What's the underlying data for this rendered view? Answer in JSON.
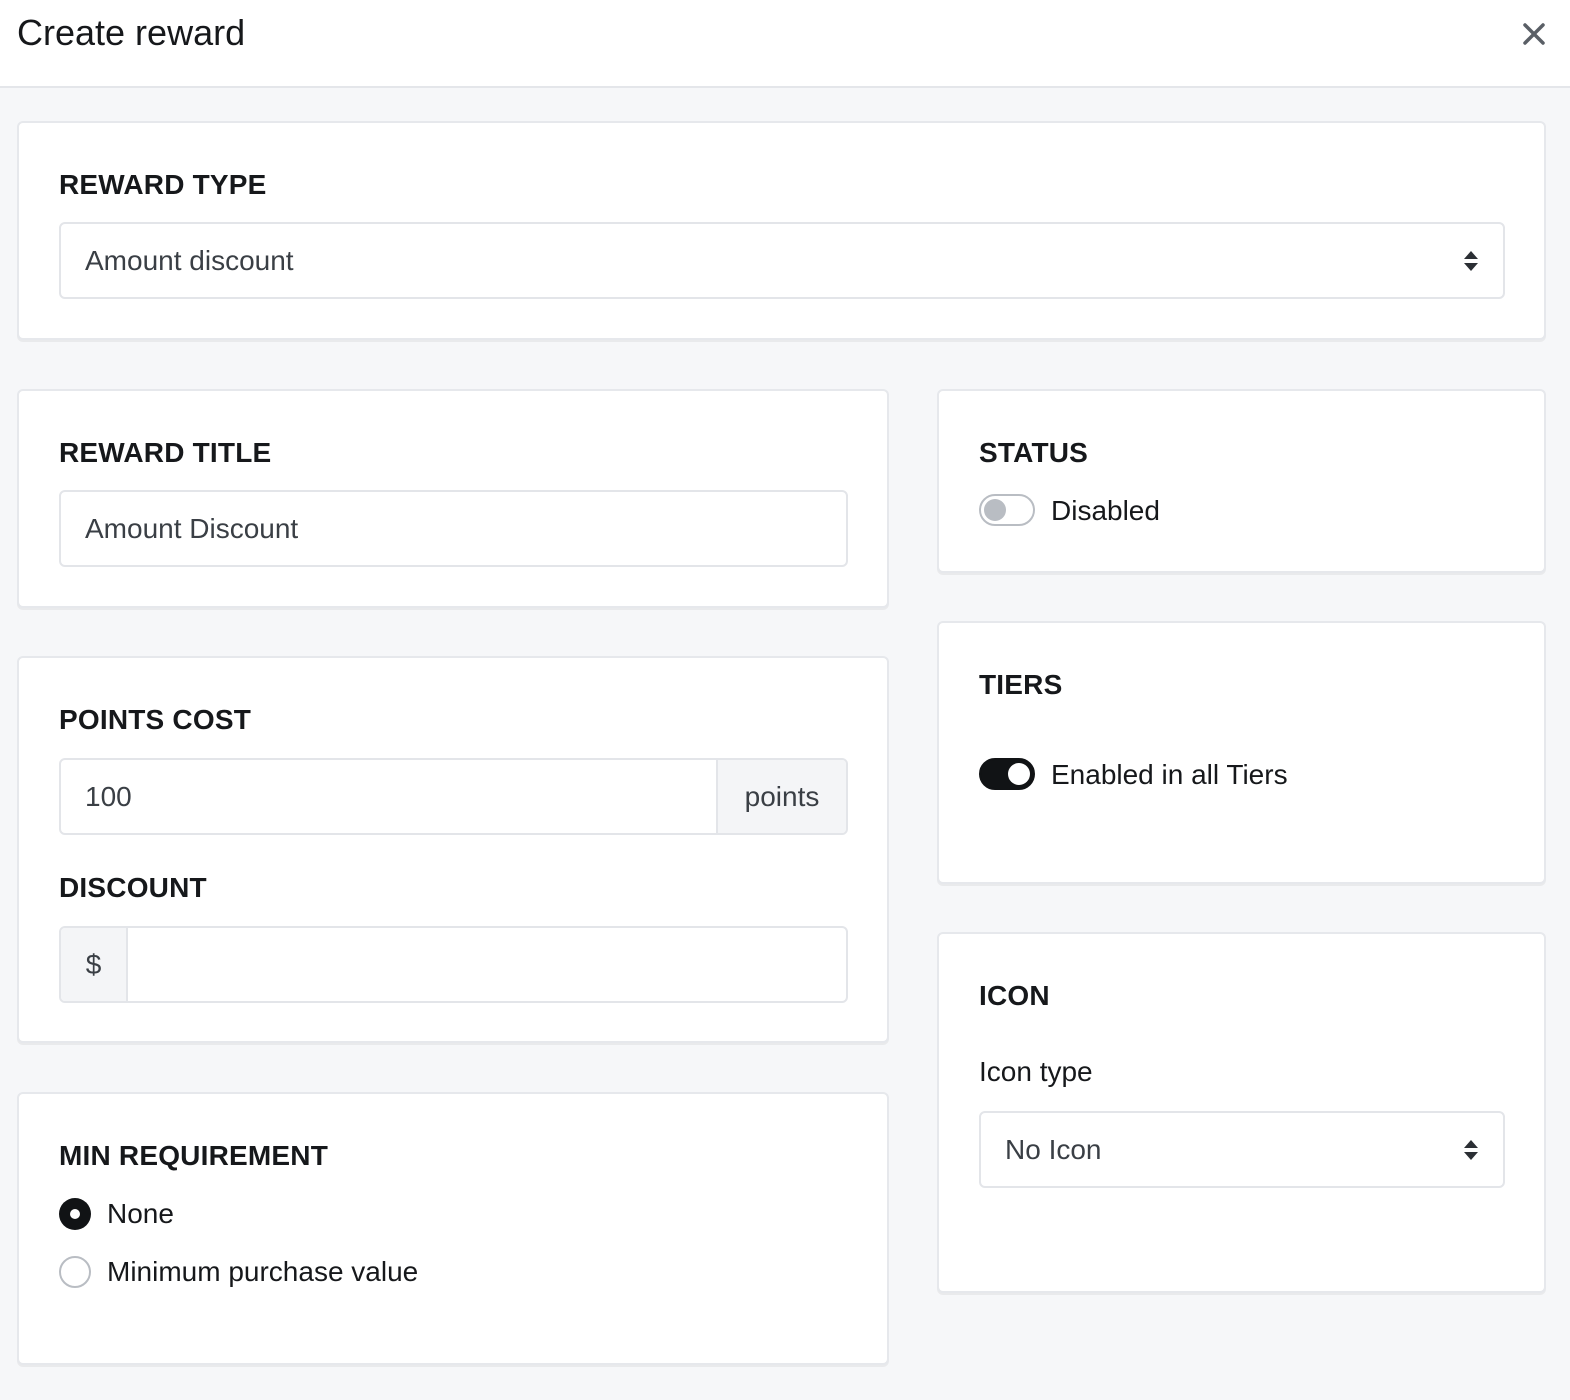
{
  "header": {
    "title": "Create reward"
  },
  "reward_type": {
    "label": "REWARD TYPE",
    "selected": "Amount discount"
  },
  "reward_title": {
    "label": "REWARD TITLE",
    "value": "Amount Discount"
  },
  "points_cost": {
    "label": "POINTS COST",
    "value": "100",
    "suffix": "points"
  },
  "discount": {
    "label": "DISCOUNT",
    "prefix": "$",
    "value": ""
  },
  "min_requirement": {
    "label": "MIN REQUIREMENT",
    "options": [
      {
        "label": "None",
        "checked": true
      },
      {
        "label": "Minimum purchase value",
        "checked": false
      }
    ]
  },
  "status": {
    "label": "STATUS",
    "toggle_label": "Disabled",
    "enabled": false
  },
  "tiers": {
    "label": "TIERS",
    "toggle_label": "Enabled in all Tiers",
    "enabled": true
  },
  "icon": {
    "label": "ICON",
    "type_label": "Icon type",
    "selected": "No Icon"
  },
  "icons": {
    "close": "close-icon",
    "select_arrows": "sort-arrows-icon"
  },
  "colors": {
    "toggle_on": "#111315",
    "toggle_off": "#b9bdc3",
    "background": "#f6f7f9"
  }
}
